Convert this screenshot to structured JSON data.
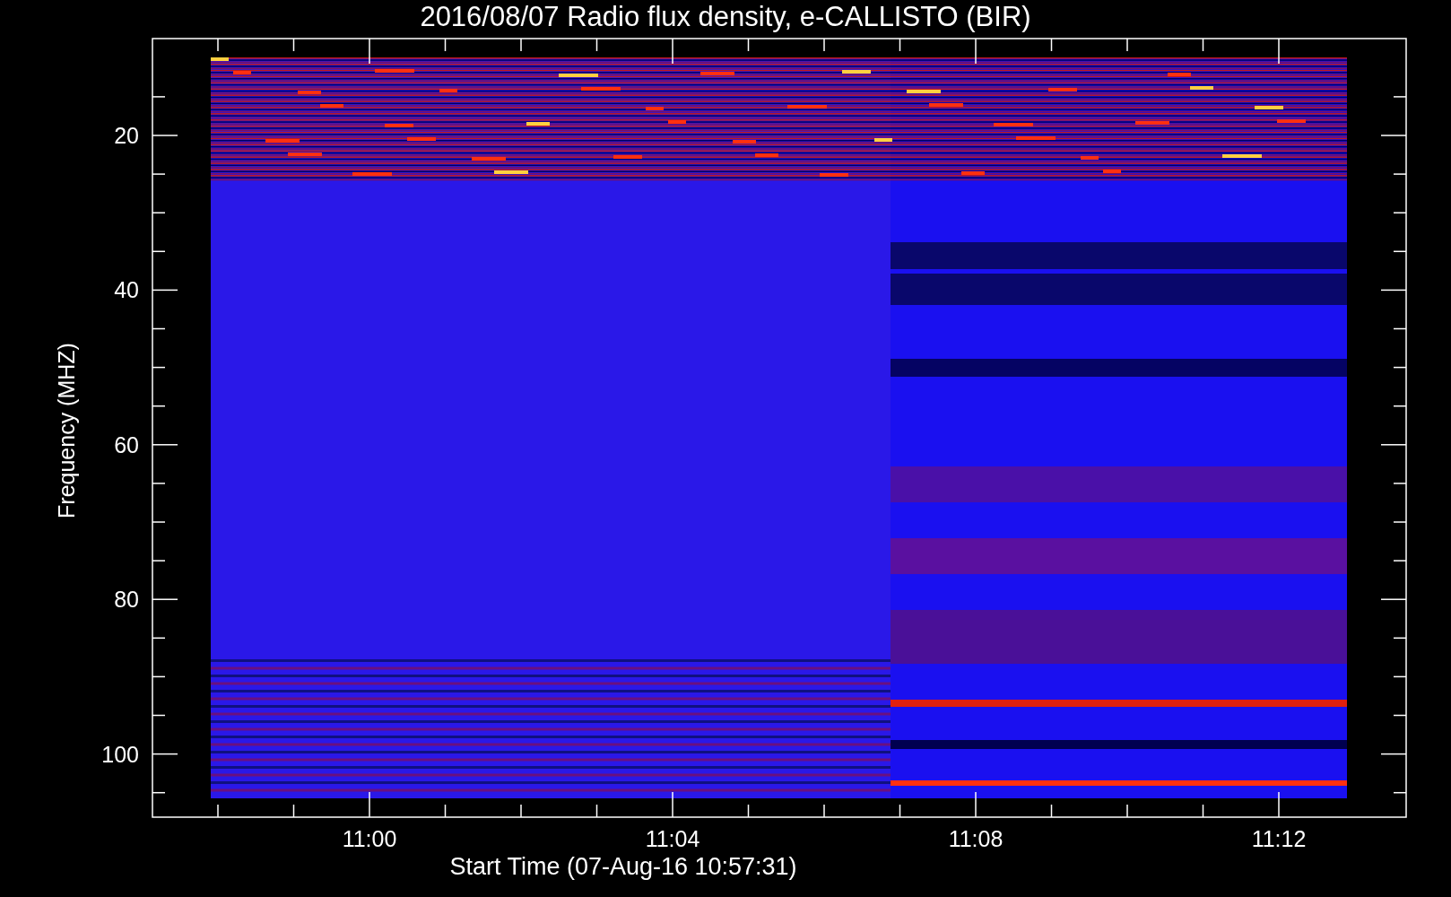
{
  "plot": {
    "title": "2016/08/07  Radio flux density, e-CALLISTO (BIR)",
    "ylabel": "Frequency (MHZ)",
    "yticks": [
      "20",
      "40",
      "60",
      "80",
      "100"
    ],
    "xticks": [
      "11:00",
      "11:04",
      "11:08",
      "11:12"
    ],
    "xlabel": "Start Time (07-Aug-16 10:57:31)"
  }
}
